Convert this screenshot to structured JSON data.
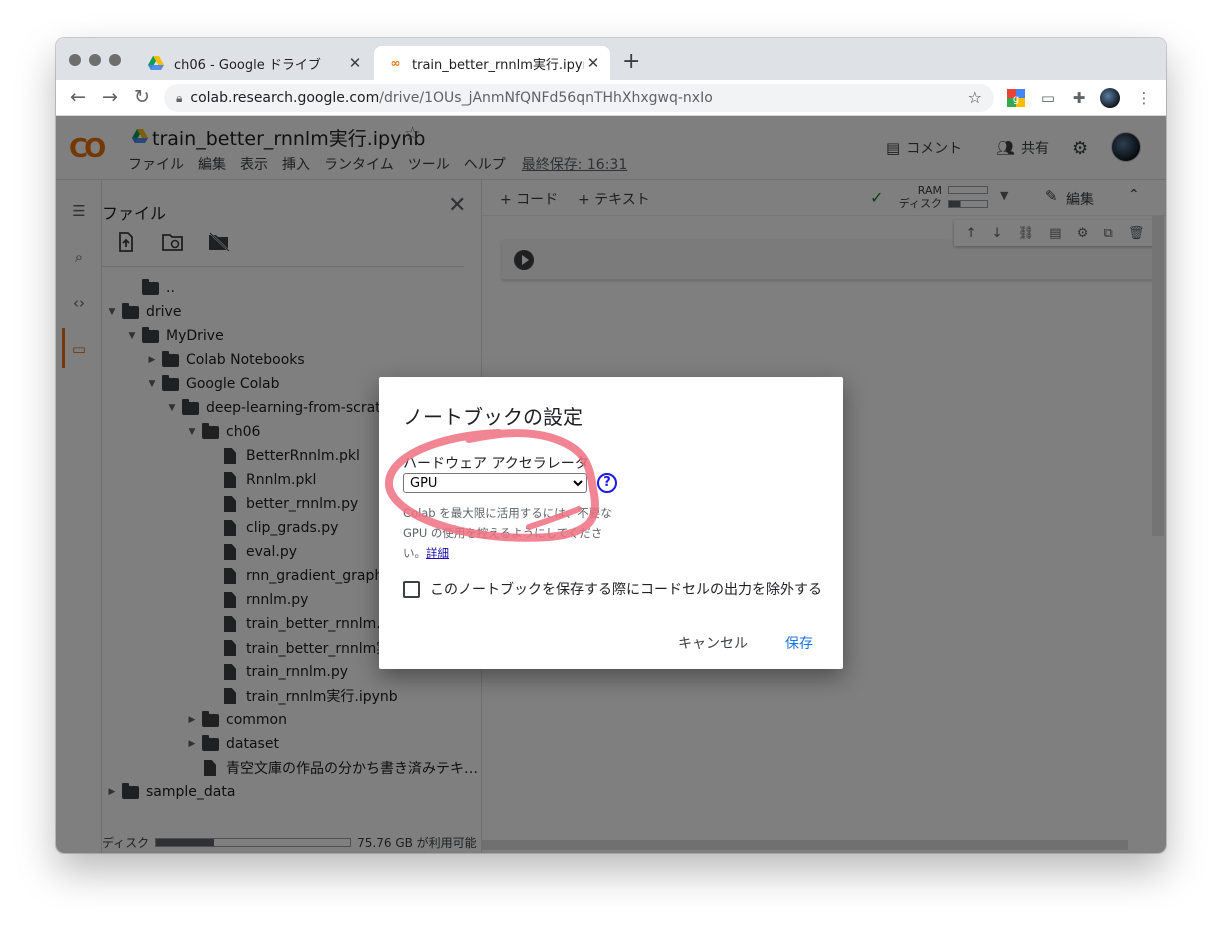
{
  "browser": {
    "tabs": [
      {
        "title": "ch06 - Google ドライブ",
        "favicon": "google-drive-icon",
        "active": false
      },
      {
        "title": "train_better_rnnlm実行.ipynb -",
        "favicon": "colab-icon",
        "active": true
      }
    ],
    "new_tab": "+",
    "url_host": "colab.research.google.com",
    "url_path": "/drive/1OUs_jAnmNfQNFd56qnTHhXhxgwq-nxIo"
  },
  "colab": {
    "logo": "CO",
    "notebook_title": "train_better_rnnlm実行.ipynb",
    "menu": [
      "ファイル",
      "編集",
      "表示",
      "挿入",
      "ランタイム",
      "ツール",
      "ヘルプ"
    ],
    "last_saved": "最終保存: 16:31",
    "comment": "コメント",
    "share": "共有",
    "add_code": "+ コード",
    "add_text": "+ テキスト",
    "ram": "RAM",
    "disk": "ディスク",
    "edit": "編集"
  },
  "files_panel": {
    "title": "ファイル",
    "tree": [
      {
        "name": "..",
        "type": "upfolder",
        "depth": 1,
        "arrow": ""
      },
      {
        "name": "drive",
        "type": "folder",
        "depth": 0,
        "arrow": "▼"
      },
      {
        "name": "MyDrive",
        "type": "folder",
        "depth": 1,
        "arrow": "▼"
      },
      {
        "name": "Colab Notebooks",
        "type": "folder",
        "depth": 2,
        "arrow": "▶"
      },
      {
        "name": "Google Colab",
        "type": "folder",
        "depth": 2,
        "arrow": "▼"
      },
      {
        "name": "deep-learning-from-scratch-",
        "type": "folder",
        "depth": 3,
        "arrow": "▼"
      },
      {
        "name": "ch06",
        "type": "folder",
        "depth": 4,
        "arrow": "▼"
      },
      {
        "name": "BetterRnnlm.pkl",
        "type": "file",
        "depth": 5,
        "arrow": ""
      },
      {
        "name": "Rnnlm.pkl",
        "type": "file",
        "depth": 5,
        "arrow": ""
      },
      {
        "name": "better_rnnlm.py",
        "type": "file",
        "depth": 5,
        "arrow": ""
      },
      {
        "name": "clip_grads.py",
        "type": "file",
        "depth": 5,
        "arrow": ""
      },
      {
        "name": "eval.py",
        "type": "file",
        "depth": 5,
        "arrow": ""
      },
      {
        "name": "rnn_gradient_graph.py",
        "type": "file",
        "depth": 5,
        "arrow": ""
      },
      {
        "name": "rnnlm.py",
        "type": "file",
        "depth": 5,
        "arrow": ""
      },
      {
        "name": "train_better_rnnlm.py",
        "type": "file",
        "depth": 5,
        "arrow": ""
      },
      {
        "name": "train_better_rnnlm実",
        "type": "file",
        "depth": 5,
        "arrow": ""
      },
      {
        "name": "train_rnnlm.py",
        "type": "file",
        "depth": 5,
        "arrow": ""
      },
      {
        "name": "train_rnnlm実行.ipynb",
        "type": "file",
        "depth": 5,
        "arrow": ""
      },
      {
        "name": "common",
        "type": "folder",
        "depth": 4,
        "arrow": "▶"
      },
      {
        "name": "dataset",
        "type": "folder",
        "depth": 4,
        "arrow": "▶"
      },
      {
        "name": "青空文庫の作品の分かち書き済みテキ…",
        "type": "file",
        "depth": 4,
        "arrow": ""
      },
      {
        "name": "sample_data",
        "type": "folder",
        "depth": 0,
        "arrow": "▶"
      }
    ],
    "disk_label": "ディスク",
    "disk_used_fraction": 0.3,
    "disk_free": "75.76 GB が利用可能"
  },
  "dialog": {
    "title": "ノートブックの設定",
    "accelerator_label": "ハードウェア アクセラレータ",
    "accelerator_value": "GPU",
    "help": "?",
    "hint_line1": "Colab を最大限に活用するには、不要な",
    "hint_line2": "GPU の使用を控えるようにしてくださ",
    "hint_line3": "い。",
    "hint_link": "詳細",
    "omit_output_label": "このノートブックを保存する際にコードセルの出力を除外する",
    "cancel": "キャンセル",
    "save": "保存"
  },
  "colors": {
    "accent_orange": "#e8710a",
    "save_blue": "#1a73e8",
    "annotation_red": "#f07080",
    "check_green": "#188038"
  }
}
